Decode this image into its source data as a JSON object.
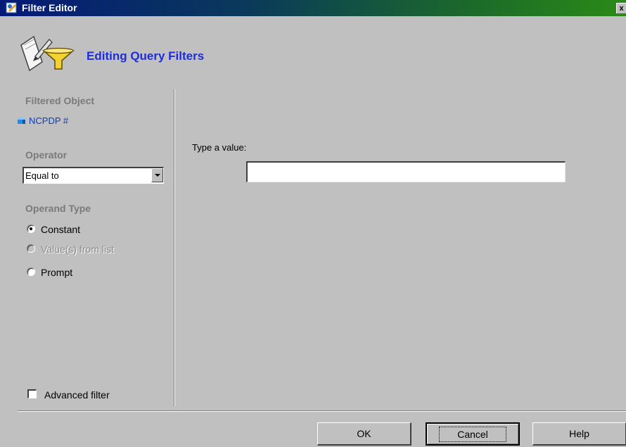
{
  "window": {
    "title": "Filter Editor",
    "close_label": "x"
  },
  "header": {
    "title": "Editing Query Filters",
    "icon": "filter-edit-icon"
  },
  "left": {
    "filtered_object_heading": "Filtered Object",
    "filtered_object_name": "NCPDP #",
    "filtered_object_icon": "object-icon",
    "operator_heading": "Operator",
    "operator_value": "Equal to",
    "operand_type_heading": "Operand Type",
    "operand_options": [
      {
        "label": "Constant",
        "selected": true,
        "enabled": true
      },
      {
        "label": "Value(s) from list",
        "selected": false,
        "enabled": false
      },
      {
        "label": "Prompt",
        "selected": false,
        "enabled": true
      }
    ],
    "advanced_filter_label": "Advanced filter",
    "advanced_filter_checked": false
  },
  "right": {
    "value_label": "Type a value:",
    "value": "",
    "placeholder": ""
  },
  "buttons": {
    "ok": "OK",
    "cancel": "Cancel",
    "help": "Help"
  },
  "colors": {
    "title_gradient_start": "#051a78",
    "title_gradient_end": "#2b8a16",
    "header_text": "#1d2ce0",
    "object_text": "#0b3cc4"
  }
}
